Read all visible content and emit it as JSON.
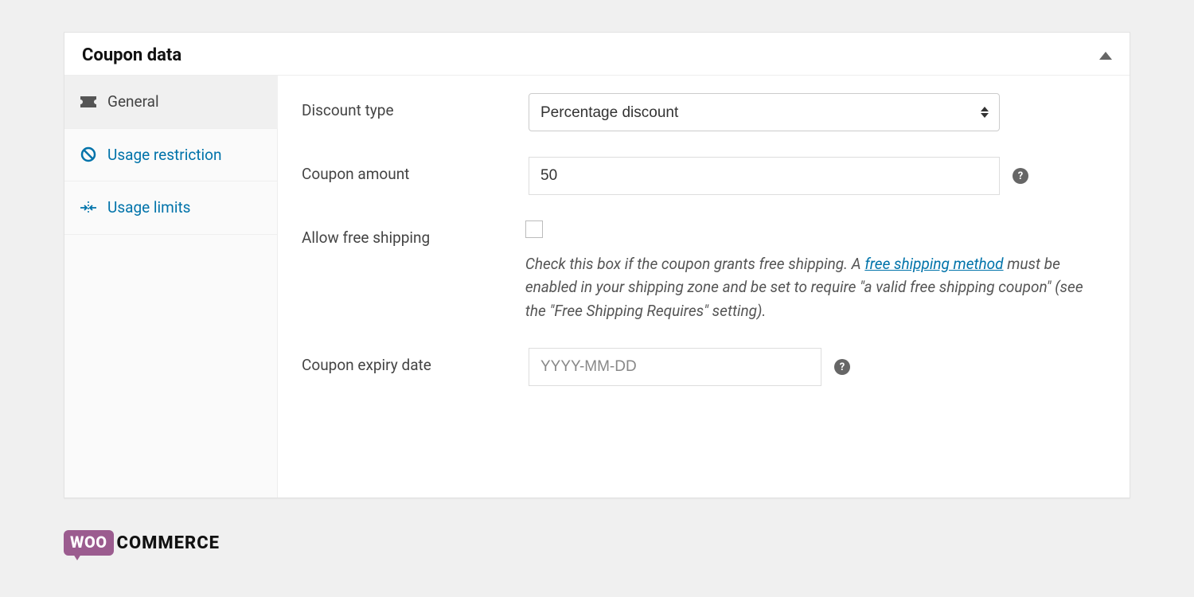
{
  "panel": {
    "title": "Coupon data"
  },
  "tabs": [
    {
      "id": "general",
      "label": "General",
      "active": true
    },
    {
      "id": "usage_restriction",
      "label": "Usage restriction",
      "active": false
    },
    {
      "id": "usage_limits",
      "label": "Usage limits",
      "active": false
    }
  ],
  "fields": {
    "discount_type": {
      "label": "Discount type",
      "value": "Percentage discount"
    },
    "coupon_amount": {
      "label": "Coupon amount",
      "value": "50"
    },
    "allow_free_shipping": {
      "label": "Allow free shipping",
      "checked": false,
      "description_pre": "Check this box if the coupon grants free shipping. A ",
      "link_text": "free shipping method",
      "description_post": " must be enabled in your shipping zone and be set to require \"a valid free shipping coupon\" (see the \"Free Shipping Requires\" setting)."
    },
    "coupon_expiry": {
      "label": "Coupon expiry date",
      "value": "",
      "placeholder": "YYYY-MM-DD"
    }
  },
  "branding": {
    "woo": "WOO",
    "commerce": "COMMERCE"
  }
}
